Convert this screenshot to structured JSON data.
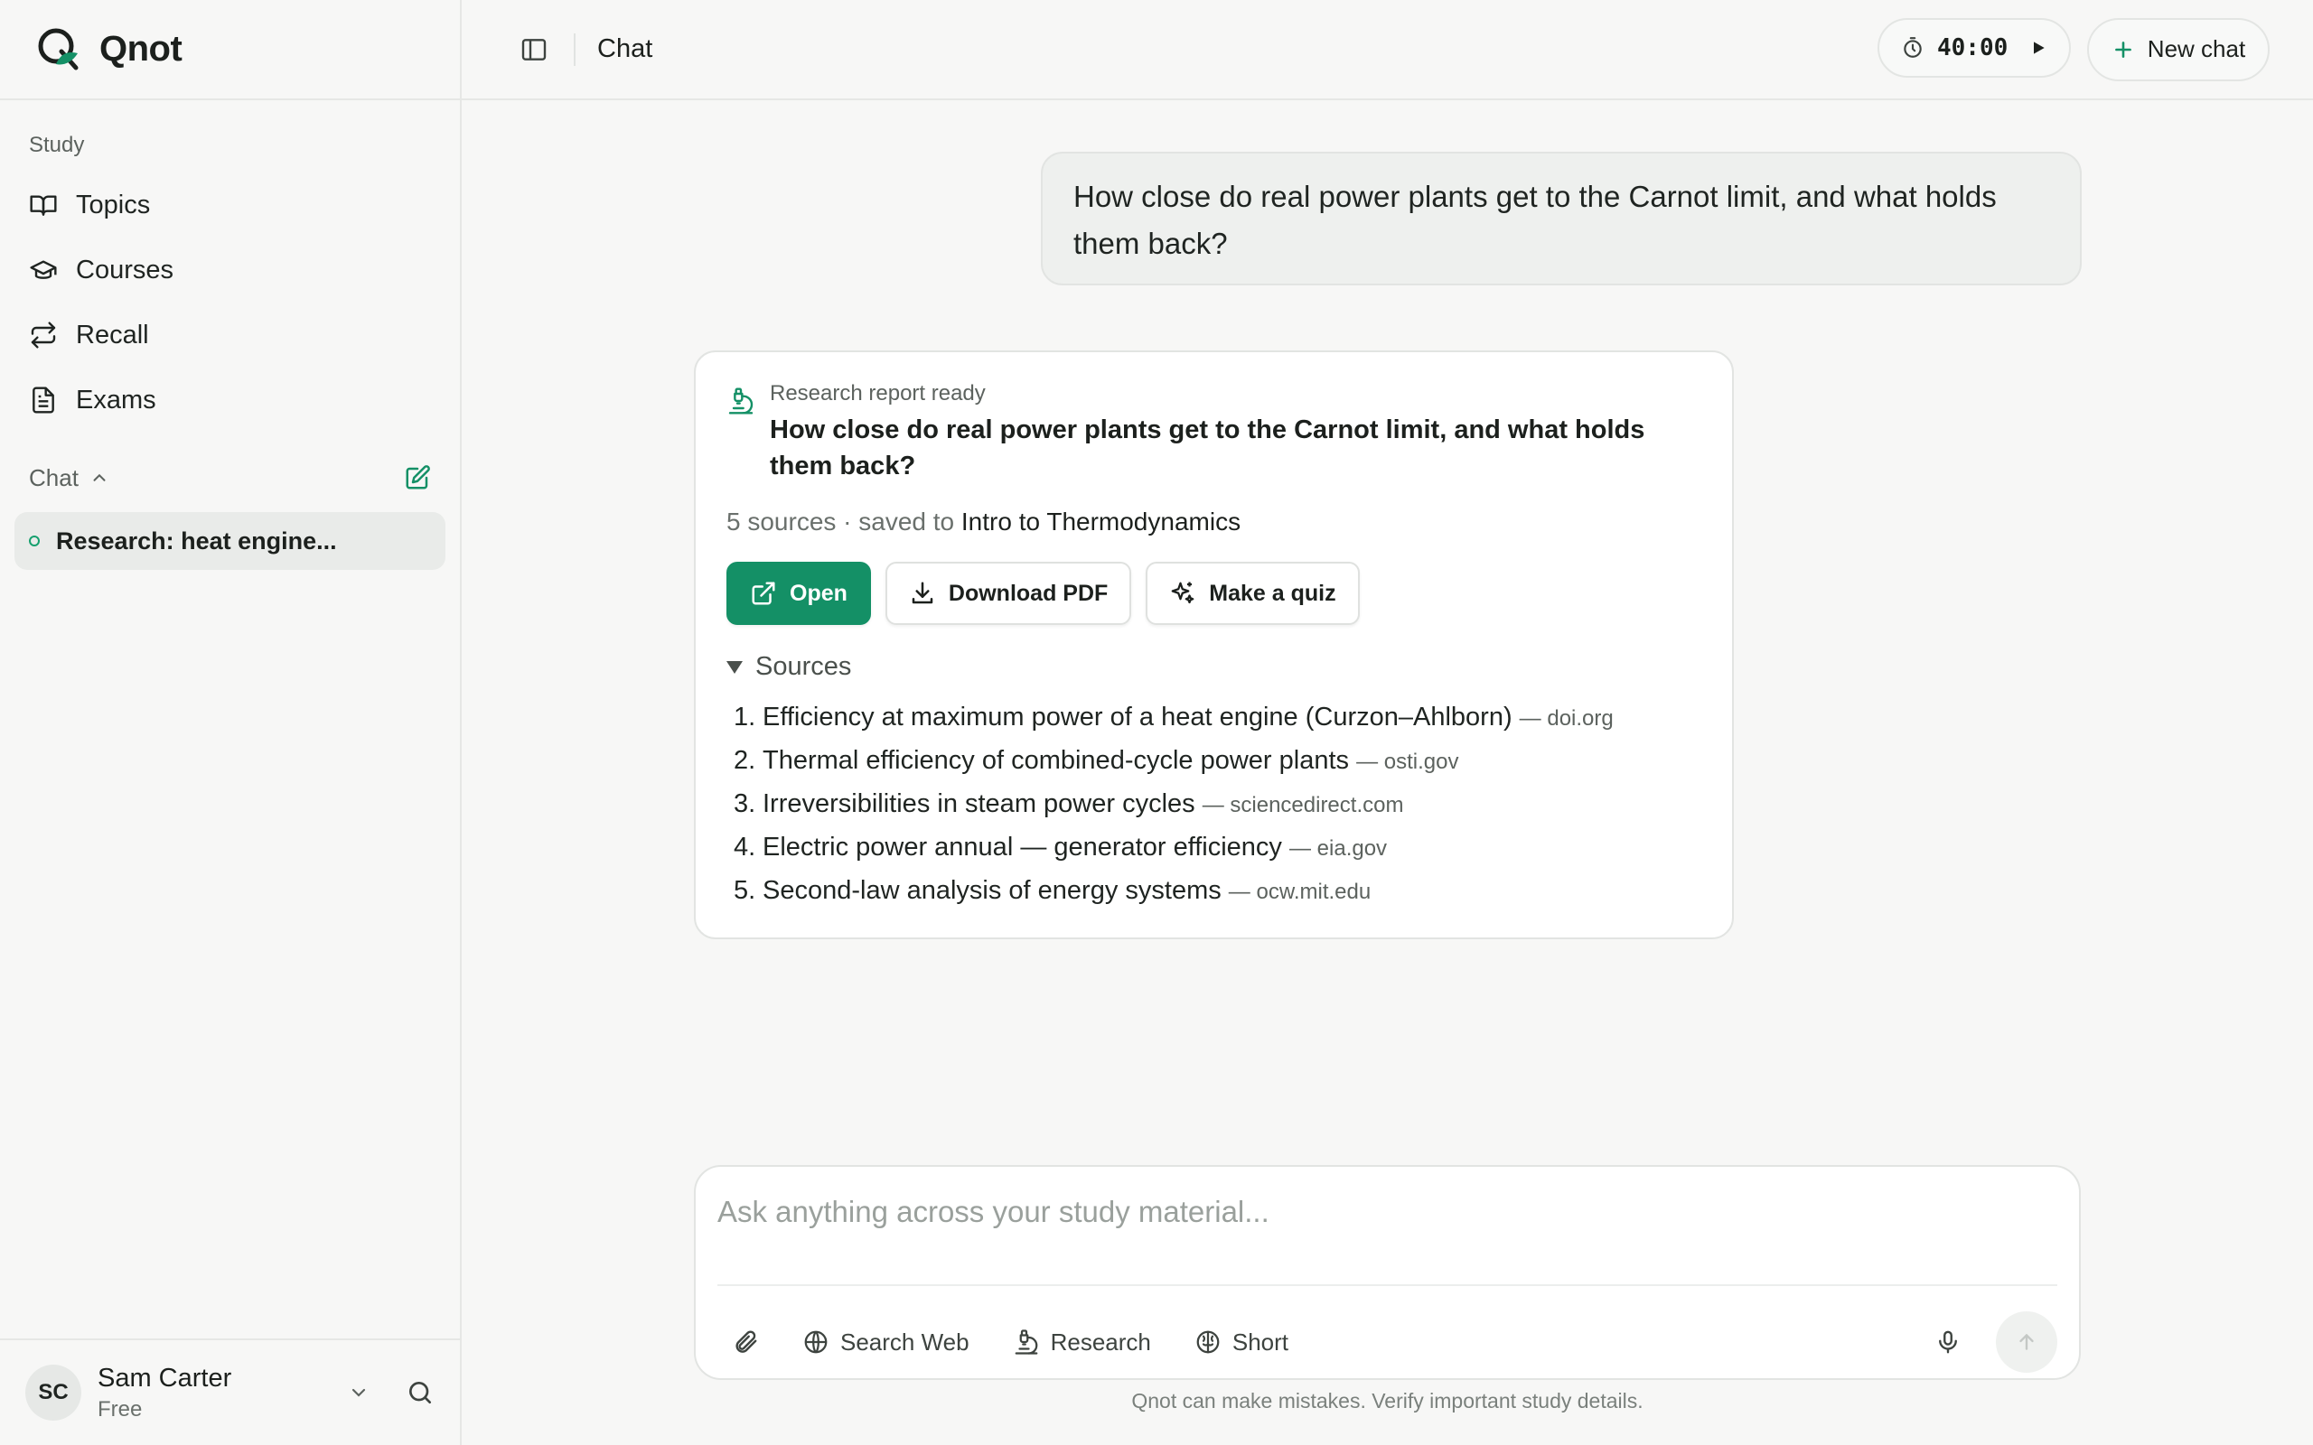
{
  "app": {
    "name": "Qnot"
  },
  "sidebar": {
    "study_label": "Study",
    "items": [
      {
        "label": "Topics",
        "icon": "book-open-icon"
      },
      {
        "label": "Courses",
        "icon": "graduation-cap-icon"
      },
      {
        "label": "Recall",
        "icon": "repeat-icon"
      },
      {
        "label": "Exams",
        "icon": "file-text-icon"
      }
    ],
    "chat_label": "Chat",
    "chats": [
      {
        "label": "Research: heat engine..."
      }
    ],
    "user": {
      "initials": "SC",
      "name": "Sam Carter",
      "plan": "Free"
    }
  },
  "topbar": {
    "title": "Chat",
    "timer": "40:00",
    "new_chat_label": "New chat"
  },
  "conversation": {
    "user_message": "How close do real power plants get to the Carnot limit, and what holds them back?",
    "report": {
      "status": "Research report ready",
      "title": "How close do real power plants get to the Carnot limit, and what holds them back?",
      "meta_prefix": "5 sources · saved to ",
      "meta_course": "Intro to Thermodynamics",
      "buttons": {
        "open": "Open",
        "download": "Download PDF",
        "quiz": "Make a quiz"
      },
      "sources_label": "Sources",
      "sources": [
        {
          "num": "1.",
          "title": "Efficiency at maximum power of a heat engine (Curzon–Ahlborn)",
          "domain": "— doi.org"
        },
        {
          "num": "2.",
          "title": "Thermal efficiency of combined-cycle power plants",
          "domain": "— osti.gov"
        },
        {
          "num": "3.",
          "title": "Irreversibilities in steam power cycles",
          "domain": "— sciencedirect.com"
        },
        {
          "num": "4.",
          "title": "Electric power annual — generator efficiency",
          "domain": "— eia.gov"
        },
        {
          "num": "5.",
          "title": "Second-law analysis of energy systems",
          "domain": "— ocw.mit.edu"
        }
      ]
    }
  },
  "composer": {
    "placeholder": "Ask anything across your study material...",
    "tools": {
      "search_web": "Search Web",
      "research": "Research",
      "short": "Short"
    },
    "disclaimer": "Qnot can make mistakes. Verify important study details."
  },
  "colors": {
    "accent": "#149066",
    "background": "#f7f7f6",
    "card": "#ffffff"
  }
}
